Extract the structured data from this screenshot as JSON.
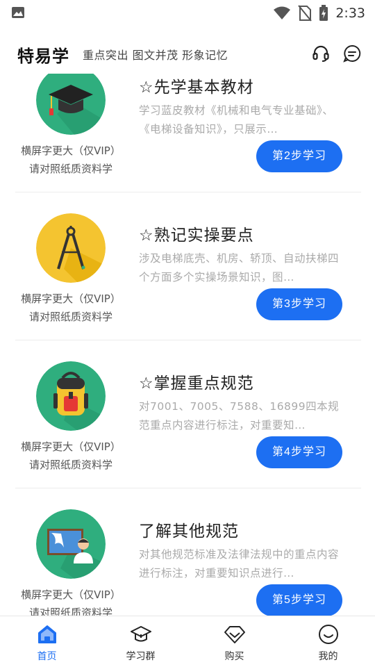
{
  "status_bar": {
    "time": "2:33",
    "icons": [
      "image-icon",
      "wifi-icon",
      "no-sim-icon",
      "battery-charging-icon"
    ]
  },
  "header": {
    "title": "特易学",
    "slogan": "重点突出 图文并茂 形象记忆",
    "icons": [
      "headset-icon",
      "message-icon"
    ]
  },
  "colors": {
    "accent": "#1d6ff2",
    "desc_text": "#aaaaaa",
    "thumb_bg_green": "#2fae7e",
    "thumb_bg_yellow": "#f4c430"
  },
  "cards": [
    {
      "title": "☆先学基本教材",
      "desc": "学习蓝皮教材《机械和电气专业基础》、《电梯设备知识》，只展示…",
      "vip_line1": "横屏字更大（仅VIP）",
      "vip_line2": "请对照纸质资料学",
      "button": "第2步学习",
      "icon": "graduation-cap-icon"
    },
    {
      "title": "☆熟记实操要点",
      "desc": "涉及电梯底壳、机房、轿顶、自动扶梯四个方面多个实操场景知识，图…",
      "vip_line1": "横屏字更大（仅VIP）",
      "vip_line2": "请对照纸质资料学",
      "button": "第3步学习",
      "icon": "compass-icon"
    },
    {
      "title": "☆掌握重点规范",
      "desc": "对7001、7005、7588、16899四本规范重点内容进行标注，对重要知…",
      "vip_line1": "横屏字更大（仅VIP）",
      "vip_line2": "请对照纸质资料学",
      "button": "第4步学习",
      "icon": "backpack-icon"
    },
    {
      "title": "了解其他规范",
      "desc": "对其他规范标准及法律法规中的重点内容进行标注，对重要知识点进行…",
      "vip_line1": "横屏字更大（仅VIP）",
      "vip_line2": "请对照纸质资料学",
      "button": "第5步学习",
      "icon": "teacher-board-icon"
    }
  ],
  "bottom_nav": [
    {
      "label": "首页",
      "icon": "home-icon",
      "active": true
    },
    {
      "label": "学习群",
      "icon": "graduation-cap-icon",
      "active": false
    },
    {
      "label": "购买",
      "icon": "diamond-icon",
      "active": false
    },
    {
      "label": "我的",
      "icon": "smile-icon",
      "active": false
    }
  ]
}
